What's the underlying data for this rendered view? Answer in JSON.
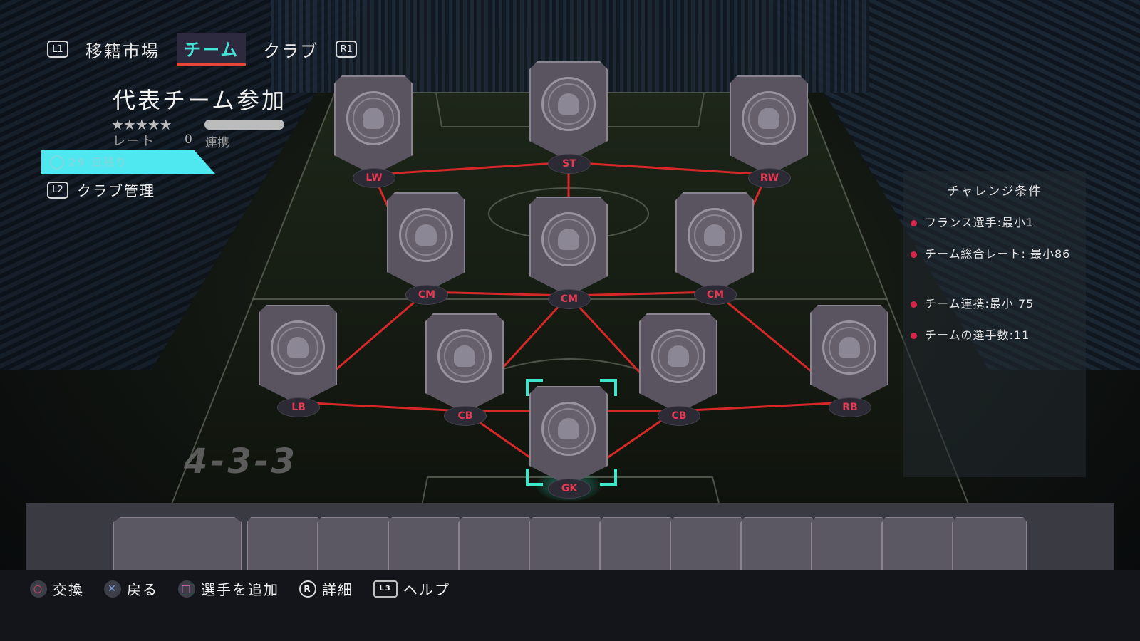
{
  "nav": {
    "l1": "L1",
    "r1": "R1",
    "tabs": [
      {
        "label": "移籍市場",
        "active": false
      },
      {
        "label": "チーム",
        "active": true
      },
      {
        "label": "クラブ",
        "active": false
      }
    ]
  },
  "challenge": {
    "title": "代表チーム参加",
    "stars": "★★★★★",
    "rating_label": "レート",
    "rating_value": "0",
    "chemistry_label": "連携",
    "timer": "29 日残り",
    "l2": "L2",
    "club_management": "クラブ管理",
    "formation": "4-3-3"
  },
  "requirements": {
    "title": "チャレンジ条件",
    "items": [
      "フランス選手:最小1",
      "チーム総合レート: 最小86",
      "チーム連携:最小 75",
      "チームの選手数:11"
    ]
  },
  "positions": {
    "lw": "LW",
    "st": "ST",
    "rw": "RW",
    "cm_left": "CM",
    "cm_center": "CM",
    "cm_right": "CM",
    "lb": "LB",
    "cb_left": "CB",
    "gk": "GK",
    "cb_right": "CB",
    "rb": "RB"
  },
  "controls": {
    "swap": "交換",
    "back": "戻る",
    "add_player": "選手を追加",
    "details": "詳細",
    "help": "ヘルプ",
    "r_label": "R",
    "l3_label": "L3"
  },
  "colors": {
    "accent": "#46e3d6",
    "link_red": "#e8463a",
    "position_red": "#e53a54",
    "timer_bg": "#4fe7f0"
  },
  "icons": {
    "circle_button": "circle-button-icon",
    "cross_button": "cross-button-icon",
    "square_button": "square-button-icon",
    "right_stick": "right-stick-icon",
    "touchpad": "touchpad-icon",
    "timer": "timer-icon",
    "player_placeholder": "player-silhouette-icon"
  }
}
